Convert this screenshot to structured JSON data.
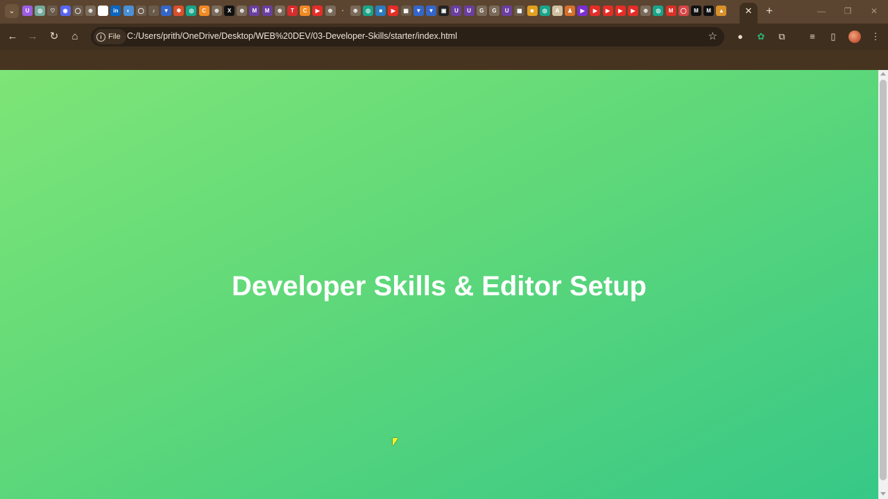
{
  "tabstrip": {
    "active_tab_close": "✕",
    "new_tab": "+",
    "pinned_tabs": [
      {
        "icon": "pinned-site-icon",
        "glyph": "U",
        "color": "#9c5de0"
      },
      {
        "icon": "openai-icon",
        "glyph": "◎",
        "color": "#74aa9c"
      },
      {
        "icon": "heart-icon",
        "glyph": "♡",
        "color": "#6a5a4a"
      },
      {
        "icon": "discord-icon",
        "glyph": "◉",
        "color": "#5865f2"
      },
      {
        "icon": "github-icon",
        "glyph": "◯",
        "color": "#6a5a4a"
      },
      {
        "icon": "globe-icon",
        "glyph": "⊕",
        "color": "#7a6a5a"
      },
      {
        "icon": "site-icon",
        "glyph": "○",
        "color": "#ffffff"
      },
      {
        "icon": "linkedin-icon",
        "glyph": "in",
        "color": "#0a66c2"
      },
      {
        "icon": "globe-icon",
        "glyph": "◐",
        "color": "#4b8fd6"
      },
      {
        "icon": "github-icon",
        "glyph": "◯",
        "color": "#6a5a4a"
      },
      {
        "icon": "bell-icon",
        "glyph": "♪",
        "color": "#6a5a4a"
      },
      {
        "icon": "shield-icon",
        "glyph": "▼",
        "color": "#3566c9"
      },
      {
        "icon": "gear-icon",
        "glyph": "✱",
        "color": "#d8502a"
      },
      {
        "icon": "chatgpt-icon",
        "glyph": "◎",
        "color": "#19a58a"
      },
      {
        "icon": "code-icon",
        "glyph": "C",
        "color": "#f08a24"
      },
      {
        "icon": "globe-icon",
        "glyph": "⊕",
        "color": "#7a6a5a"
      },
      {
        "icon": "x-icon",
        "glyph": "X",
        "color": "#111111"
      },
      {
        "icon": "globe-icon",
        "glyph": "⊕",
        "color": "#7a6a5a"
      },
      {
        "icon": "m-icon",
        "glyph": "M",
        "color": "#6b3fa0"
      },
      {
        "icon": "m-icon",
        "glyph": "M",
        "color": "#6b3fa0"
      },
      {
        "icon": "globe-icon",
        "glyph": "⊕",
        "color": "#7a6a5a"
      },
      {
        "icon": "tuf-icon",
        "glyph": "T",
        "color": "#d62d2d"
      },
      {
        "icon": "code-icon",
        "glyph": "C",
        "color": "#f08a24"
      },
      {
        "icon": "youtube-icon",
        "glyph": "▶",
        "color": "#e52d27"
      },
      {
        "icon": "globe-icon",
        "glyph": "⊕",
        "color": "#7a6a5a"
      },
      {
        "icon": "site-icon",
        "glyph": "·",
        "color": "#5b4531"
      },
      {
        "icon": "globe-icon",
        "glyph": "⊕",
        "color": "#7a6a5a"
      },
      {
        "icon": "chatgpt-icon",
        "glyph": "◎",
        "color": "#19a58a"
      },
      {
        "icon": "square-icon",
        "glyph": "■",
        "color": "#2b7bbf"
      },
      {
        "icon": "youtube-icon",
        "glyph": "▶",
        "color": "#e52d27"
      },
      {
        "icon": "grid-icon",
        "glyph": "▦",
        "color": "#6a5a4a"
      },
      {
        "icon": "shield-icon",
        "glyph": "▼",
        "color": "#3566c9"
      },
      {
        "icon": "shield-icon",
        "glyph": "▼",
        "color": "#3566c9"
      },
      {
        "icon": "terminal-icon",
        "glyph": "▣",
        "color": "#222222"
      },
      {
        "icon": "u-icon",
        "glyph": "U",
        "color": "#6b3fa0"
      },
      {
        "icon": "u-icon",
        "glyph": "U",
        "color": "#6b3fa0"
      },
      {
        "icon": "google-icon",
        "glyph": "G",
        "color": "#7a6a5a"
      },
      {
        "icon": "google-icon",
        "glyph": "G",
        "color": "#7a6a5a"
      },
      {
        "icon": "u-icon",
        "glyph": "U",
        "color": "#6b3fa0"
      },
      {
        "icon": "grid-icon",
        "glyph": "▦",
        "color": "#6a5a4a"
      },
      {
        "icon": "cat-icon",
        "glyph": "☻",
        "color": "#e0a020"
      },
      {
        "icon": "chatgpt-icon",
        "glyph": "◎",
        "color": "#19a58a"
      },
      {
        "icon": "book-icon",
        "glyph": "A",
        "color": "#d0c0a0"
      },
      {
        "icon": "person-icon",
        "glyph": "♟",
        "color": "#d8702a"
      },
      {
        "icon": "play-icon",
        "glyph": "▶",
        "color": "#7b2fd0"
      },
      {
        "icon": "youtube-icon",
        "glyph": "▶",
        "color": "#e52d27"
      },
      {
        "icon": "youtube-icon",
        "glyph": "▶",
        "color": "#e52d27"
      },
      {
        "icon": "youtube-icon",
        "glyph": "▶",
        "color": "#e52d27"
      },
      {
        "icon": "youtube-icon",
        "glyph": "▶",
        "color": "#e52d27"
      },
      {
        "icon": "globe-icon",
        "glyph": "⊕",
        "color": "#7a6a5a"
      },
      {
        "icon": "chatgpt-icon",
        "glyph": "◎",
        "color": "#19a58a"
      },
      {
        "icon": "gmail-icon",
        "glyph": "M",
        "color": "#d93025"
      },
      {
        "icon": "circle-icon",
        "glyph": "◯",
        "color": "#d64545"
      },
      {
        "icon": "medium-icon",
        "glyph": "M",
        "color": "#111111"
      },
      {
        "icon": "medium-icon",
        "glyph": "M",
        "color": "#111111"
      },
      {
        "icon": "site-icon",
        "glyph": "▲",
        "color": "#d8902a"
      }
    ]
  },
  "toolbar": {
    "back": "←",
    "forward": "→",
    "reload": "↻",
    "home": "⌂",
    "site_chip_label": "File",
    "url": "C:/Users/prith/OneDrive/Desktop/WEB%20DEV/03-Developer-Skills/starter/index.html",
    "bookmark": "☆"
  },
  "page": {
    "heading": "Developer Skills & Editor Setup",
    "gradient_start": "#7ee577",
    "gradient_end": "#37c887"
  },
  "colors": {
    "tabstrip_bg": "#5b4531",
    "toolbar_bg": "#3f2f1f"
  }
}
